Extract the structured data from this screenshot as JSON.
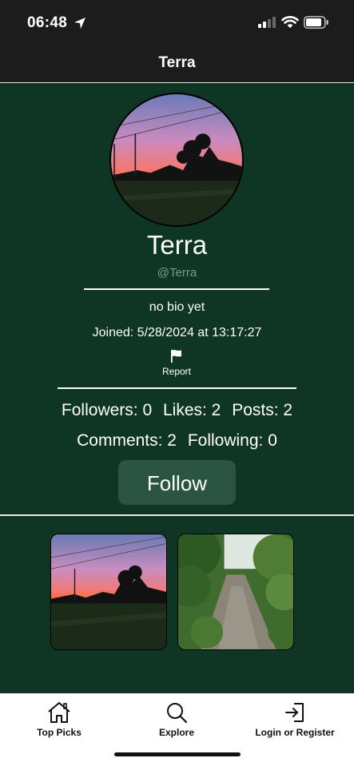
{
  "status": {
    "time": "06:48"
  },
  "nav": {
    "title": "Terra"
  },
  "profile": {
    "display_name": "Terra",
    "handle": "@Terra",
    "bio": "no bio yet",
    "joined": "Joined: 5/28/2024 at 13:17:27",
    "report_label": "Report"
  },
  "stats": {
    "followers": "Followers: 0",
    "likes": "Likes: 2",
    "posts": "Posts: 2",
    "comments": "Comments: 2",
    "following": "Following: 0"
  },
  "follow_label": "Follow",
  "tabs": [
    {
      "label": "Top Picks",
      "icon": "home-icon"
    },
    {
      "label": "Explore",
      "icon": "search-icon"
    },
    {
      "label": "Login or Register",
      "icon": "login-icon"
    }
  ],
  "colors": {
    "background": "#0f3624",
    "bar": "#1c1c1c",
    "button": "#2c5442"
  }
}
